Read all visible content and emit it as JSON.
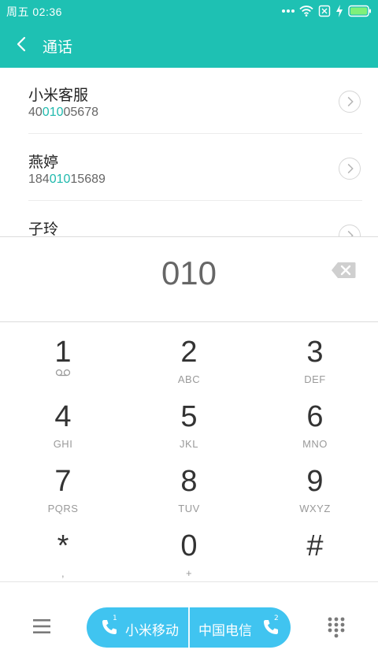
{
  "status_bar": {
    "time": "周五 02:36"
  },
  "header": {
    "title": "通话"
  },
  "results": [
    {
      "name": "小米客服",
      "number_prefix": "40",
      "number_match": "010",
      "number_suffix": "05678"
    },
    {
      "name": "燕婷",
      "number_prefix": "184",
      "number_match": "010",
      "number_suffix": "15689"
    },
    {
      "name": "子玲",
      "number_prefix": "",
      "number_match": "",
      "number_suffix": ""
    }
  ],
  "dial_input": {
    "value": "010"
  },
  "keypad": [
    {
      "digit": "1",
      "letters": ""
    },
    {
      "digit": "2",
      "letters": "ABC"
    },
    {
      "digit": "3",
      "letters": "DEF"
    },
    {
      "digit": "4",
      "letters": "GHI"
    },
    {
      "digit": "5",
      "letters": "JKL"
    },
    {
      "digit": "6",
      "letters": "MNO"
    },
    {
      "digit": "7",
      "letters": "PQRS"
    },
    {
      "digit": "8",
      "letters": "TUV"
    },
    {
      "digit": "9",
      "letters": "WXYZ"
    },
    {
      "digit": "*",
      "letters": ","
    },
    {
      "digit": "0",
      "letters": "+"
    },
    {
      "digit": "#",
      "letters": ""
    }
  ],
  "call_buttons": {
    "sim1_label": "小米移动",
    "sim1_index": "1",
    "sim2_label": "中国电信",
    "sim2_index": "2"
  },
  "colors": {
    "accent": "#1ec1b3",
    "highlight": "#1fb9ad",
    "call_button": "#40c4f0"
  },
  "icons": [
    "back-icon",
    "wifi-icon",
    "sim-missing-icon",
    "charging-icon",
    "battery-icon",
    "chevron-right-icon",
    "backspace-icon",
    "voicemail-icon",
    "menu-icon",
    "phone-icon",
    "dialpad-icon"
  ]
}
